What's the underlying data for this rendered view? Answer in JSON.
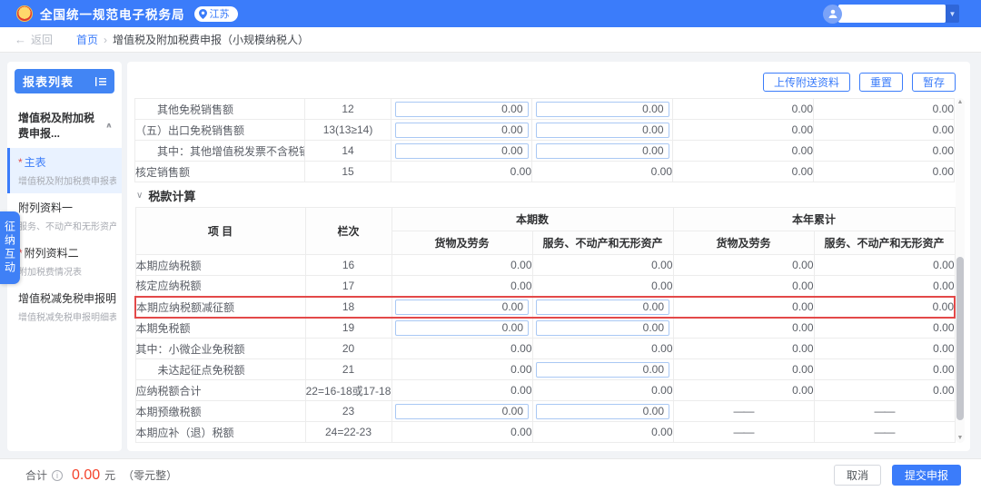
{
  "colors": {
    "accent": "#3b7cfa",
    "highlight_red": "#e34949",
    "total_red": "#f4432c"
  },
  "icons": {
    "back": "←",
    "breadcrumb_sep": "›",
    "caret_down": "▼",
    "chevron_up": "∧",
    "chevron_down": "∨",
    "scroll_up": "▲",
    "scroll_down": "▼"
  },
  "navbar": {
    "title": "全国统一规范电子税务局",
    "region": "江苏",
    "taxpayer_value": ""
  },
  "breadcrumb": {
    "back": "返回",
    "home": "首页",
    "current": "增值税及附加税费申报（小规模纳税人）"
  },
  "sidebar": {
    "title": "报表列表",
    "group": "增值税及附加税费申报...",
    "items": [
      {
        "label": "主表",
        "subtitle": "增值税及附加税费申报表",
        "required": "*"
      },
      {
        "label": "附列资料一",
        "subtitle": "服务、不动产和无形资产扣.."
      },
      {
        "label": "附列资料二",
        "subtitle": "附加税费情况表",
        "required": "*"
      },
      {
        "label": "增值税减免税申报明...",
        "subtitle": "增值税减免税申报明细表"
      }
    ],
    "floating_tab": "征纳互动"
  },
  "toolbar": {
    "upload": "上传附送资料",
    "reset": "重置",
    "save_draft": "暂存"
  },
  "table_top": {
    "rows": [
      {
        "item": "其他免税销售额",
        "col_no": "12",
        "values": [
          "0.00",
          "0.00",
          "0.00",
          "0.00"
        ]
      },
      {
        "item": "（五）出口免税销售额",
        "col_no": "13(13≥14)",
        "values": [
          "0.00",
          "0.00",
          "0.00",
          "0.00"
        ]
      },
      {
        "item": "其中：其他增值税发票不含税销售额",
        "col_no": "14",
        "values": [
          "0.00",
          "0.00",
          "0.00",
          "0.00"
        ]
      },
      {
        "item": "核定销售额",
        "col_no": "15",
        "values": [
          "0.00",
          "0.00",
          "0.00",
          "0.00"
        ]
      }
    ]
  },
  "section": {
    "title": "税款计算"
  },
  "table_main": {
    "headers": {
      "item": "项  目",
      "col_no": "栏次",
      "current": "本期数",
      "ytd": "本年累计",
      "goods": "货物及劳务",
      "services": "服务、不动产和无形资产"
    },
    "rows": [
      {
        "item": "本期应纳税额",
        "col_no": "16",
        "values": [
          "0.00",
          "0.00",
          "0.00",
          "0.00"
        ]
      },
      {
        "item": "核定应纳税额",
        "col_no": "17",
        "values": [
          "0.00",
          "0.00",
          "0.00",
          "0.00"
        ]
      },
      {
        "item": "本期应纳税额减征额",
        "col_no": "18",
        "values": [
          "0.00",
          "0.00",
          "0.00",
          "0.00"
        ]
      },
      {
        "item": "本期免税额",
        "col_no": "19",
        "values": [
          "0.00",
          "0.00",
          "0.00",
          "0.00"
        ]
      },
      {
        "item": "其中：小微企业免税额",
        "col_no": "20",
        "values": [
          "0.00",
          "0.00",
          "0.00",
          "0.00"
        ]
      },
      {
        "item": "未达起征点免税额",
        "col_no": "21",
        "values": [
          "0.00",
          "0.00",
          "0.00",
          "0.00"
        ]
      },
      {
        "item": "应纳税额合计",
        "col_no": "22=16-18或17-18",
        "values": [
          "0.00",
          "0.00",
          "0.00",
          "0.00"
        ]
      },
      {
        "item": "本期预缴税额",
        "col_no": "23",
        "values": [
          "0.00",
          "0.00",
          "——",
          "——"
        ]
      },
      {
        "item": "本期应补（退）税额",
        "col_no": "24=22-23",
        "values": [
          "0.00",
          "0.00",
          "——",
          "——"
        ]
      }
    ]
  },
  "footer": {
    "total_label": "合计",
    "total_value": "0.00",
    "unit": "元",
    "capital": "（零元整）",
    "cancel": "取消",
    "submit": "提交申报"
  }
}
